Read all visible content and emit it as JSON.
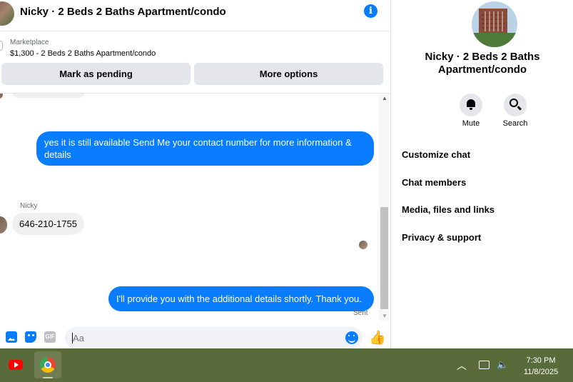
{
  "chat": {
    "title": "Nicky · 2 Beds 2 Baths Apartment/condo",
    "info_icon": "info-icon",
    "marketplace": {
      "label": "Marketplace",
      "item": "$1,300 - 2 Beds 2 Baths Apartment/condo",
      "mark_pending": "Mark as pending",
      "more_options": "More options"
    },
    "messages": [
      {
        "direction": "outgoing",
        "text": "yes it is still available Send Me your contact number for more information & details"
      },
      {
        "direction": "incoming",
        "sender": "Nicky",
        "text": "646-210-1755"
      },
      {
        "direction": "outgoing",
        "text": "I'll provide you with the additional details shortly. Thank you.",
        "status": "Sent"
      }
    ],
    "composer": {
      "placeholder": "Aa",
      "gif_label": "GIF"
    }
  },
  "info_panel": {
    "title": "Nicky · 2 Beds 2 Baths Apartment/condo",
    "actions": [
      {
        "label": "Mute",
        "icon": "bell-icon"
      },
      {
        "label": "Search",
        "icon": "search-icon"
      }
    ],
    "menu": [
      "Customize chat",
      "Chat members",
      "Media, files and links",
      "Privacy & support"
    ]
  },
  "taskbar": {
    "time": "7:30 PM",
    "date": "11/8/2025",
    "apps": [
      "youtube-icon",
      "chrome-icon"
    ]
  },
  "colors": {
    "accent": "#0a7cff",
    "taskbar": "#5a6b3b"
  }
}
